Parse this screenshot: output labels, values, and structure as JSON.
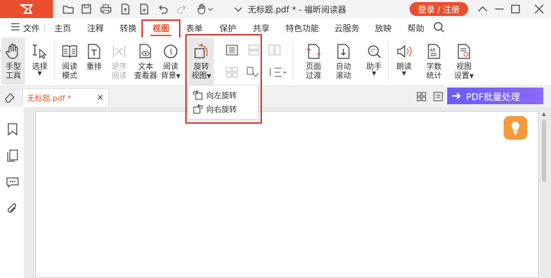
{
  "app": {
    "doc_title": "无标题.pdf * - 福昕阅读器",
    "login_label": "登录 / 注册"
  },
  "menu": {
    "file": "文件",
    "items": [
      "主页",
      "注释",
      "转换",
      "视图",
      "表单",
      "保护",
      "共享",
      "特色功能",
      "云服务",
      "放映",
      "帮助"
    ]
  },
  "ribbon": {
    "hand": "手型\n工具",
    "select": "选择",
    "read_mode": "阅读\n模式",
    "reflow": "重排",
    "reverse_read": "逆序\n阅读",
    "text_viewer": "文本\n查看器",
    "read_bg": "阅读\n背景",
    "rotate_view": "旋转\n视图",
    "page_transition": "页面\n过渡",
    "auto_scroll": "自动\n滚动",
    "assistant": "助手",
    "read_aloud": "朗读",
    "word_count": "字数\n统计",
    "view_settings": "视图\n设置"
  },
  "dropdown": {
    "rotate_left": "向左旋转",
    "rotate_right": "向右旋转"
  },
  "tab": {
    "name": "无标题.pdf *",
    "close": "×"
  },
  "banner": {
    "pdf_batch": "PDF批量处理"
  },
  "colors": {
    "brand": "#e94f2f",
    "highlight": "#d9342b",
    "banner": "#7a63f5",
    "tip": "#f39a3d"
  }
}
